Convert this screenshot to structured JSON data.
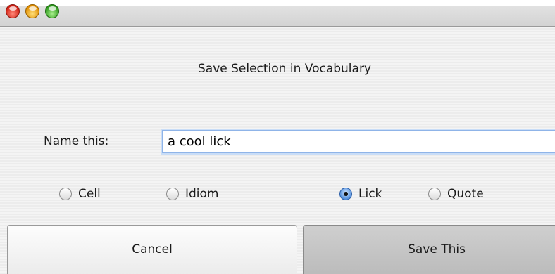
{
  "window": {
    "traffic_lights": [
      "close-icon",
      "minimize-icon",
      "zoom-icon"
    ]
  },
  "dialog": {
    "title": "Save Selection in Vocabulary",
    "name_label": "Name this:",
    "name_value": "a cool lick",
    "options": [
      {
        "label": "Cell",
        "checked": false
      },
      {
        "label": "Idiom",
        "checked": false
      },
      {
        "label": "Lick",
        "checked": true
      },
      {
        "label": "Quote",
        "checked": false
      }
    ],
    "cancel_label": "Cancel",
    "save_label": "Save This"
  },
  "colors": {
    "focus_ring": "#8fb4e8",
    "radio_selected": "#5c96e0"
  }
}
